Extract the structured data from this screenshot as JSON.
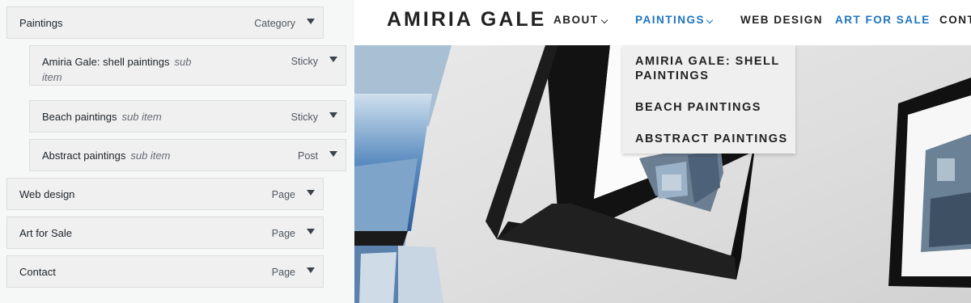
{
  "menu_editor": {
    "items": [
      {
        "title": "Paintings",
        "sub": "",
        "type": "Category"
      },
      {
        "title": "Amiria Gale: shell paintings",
        "sub": "sub item",
        "type": "Sticky"
      },
      {
        "title": "Beach paintings",
        "sub": "sub item",
        "type": "Sticky"
      },
      {
        "title": "Abstract paintings",
        "sub": "sub item",
        "type": "Post"
      },
      {
        "title": "Web design",
        "sub": "",
        "type": "Page"
      },
      {
        "title": "Art for Sale",
        "sub": "",
        "type": "Page"
      },
      {
        "title": "Contact",
        "sub": "",
        "type": "Page"
      }
    ]
  },
  "site": {
    "logo": "AMIRIA GALE",
    "nav": [
      {
        "label": "ABOUT",
        "has_dropdown": true
      },
      {
        "label": "PAINTINGS",
        "has_dropdown": true,
        "active": true
      },
      {
        "label": "WEB DESIGN",
        "has_dropdown": false
      },
      {
        "label": "ART FOR SALE",
        "has_dropdown": false,
        "highlight": true
      },
      {
        "label": "CONT",
        "has_dropdown": false
      }
    ],
    "dropdown": [
      {
        "label": "AMIRIA GALE: SHELL PAINTINGS"
      },
      {
        "label": "BEACH PAINTINGS"
      },
      {
        "label": "ABSTRACT PAINTINGS"
      }
    ],
    "colors": {
      "nav_accent": "#1e73be",
      "text": "#222222"
    }
  }
}
